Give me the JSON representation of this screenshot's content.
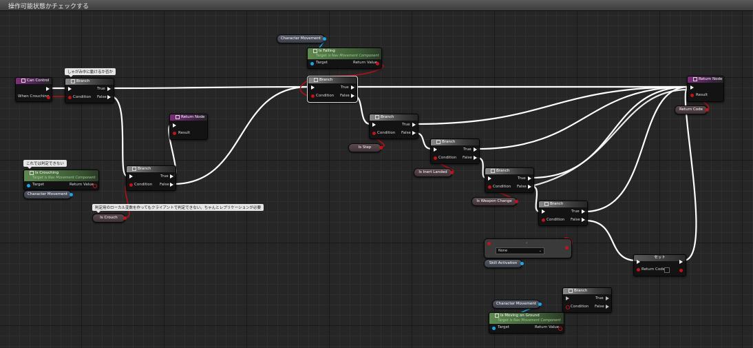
{
  "window": {
    "title": "操作可能状態かチェックする"
  },
  "colors": {
    "exec_wire": "#ffffff",
    "bool_wire": "#b0121a",
    "object_wire": "#1aa7e8"
  },
  "comments": {
    "crouch_move": "しゃがみ中に動けるか否か",
    "judge_here": "これでは判定できない",
    "local_var_note": "判定用のローカル変数を作ってもクライアントで判定できない。ちゃんとレプリケーションが必要"
  },
  "nodes": {
    "can_control": {
      "title": "Can Control",
      "pin_when_crouching": "When Crouching"
    },
    "branch_labels": {
      "title": "Branch",
      "condition": "Condition",
      "true": "True",
      "false": "False"
    },
    "return_node": {
      "title": "Return Node",
      "result": "Result"
    },
    "return_node2": {
      "title": "Return Node",
      "result": "Result"
    },
    "is_crouching": {
      "title": "Is Crouching",
      "subtitle": "Target is Nav Movement Component",
      "target": "Target",
      "return_value": "Return Value"
    },
    "is_falling": {
      "title": "Is Falling",
      "subtitle": "Target is Nav Movement Component",
      "target": "Target",
      "return_value": "Return Value"
    },
    "is_moving_on_ground": {
      "title": "Is Moving on Ground",
      "subtitle": "Target is Nav Movement Component",
      "target": "Target",
      "return_value": "Return Value"
    },
    "set_node": {
      "title": "セット",
      "return_code": "Return Code"
    },
    "enum_select": {
      "value": "None"
    }
  },
  "variables": {
    "character_movement": "Character Movement",
    "is_crouch": "Is Crouch",
    "is_step": "Is Step",
    "is_inert_landed": "Is Inert Landed",
    "is_weapon_change": "Is Weapon Change",
    "skill_activation": "Skill Activation",
    "return_code": "Return Code"
  }
}
